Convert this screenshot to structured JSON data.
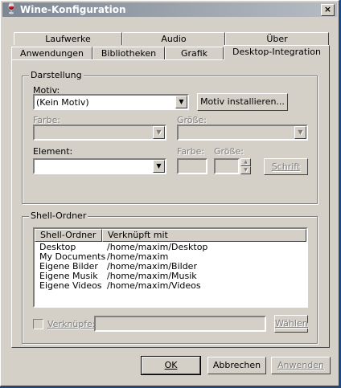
{
  "window": {
    "title": "Wine-Konfiguration",
    "icon": "wine-glass-icon",
    "close": "×"
  },
  "tabs_back": [
    "Laufwerke",
    "Audio",
    "Über"
  ],
  "tabs_front": [
    "Anwendungen",
    "Bibliotheken",
    "Grafik",
    "Desktop-Integration"
  ],
  "appearance": {
    "group_label": "Darstellung",
    "motiv_label": "Motiv:",
    "motiv_value": "(Kein Motiv)",
    "install_button": "Motiv installieren...",
    "farbe_label": "Farbe:",
    "groesse_label": "Größe:",
    "element_label": "Element:",
    "el_farbe_label": "Farbe:",
    "el_groesse_label": "Größe:",
    "schrift_button": "Schrift"
  },
  "shell": {
    "group_label": "Shell-Ordner",
    "columns": [
      "Shell-Ordner",
      "Verknüpft mit"
    ],
    "rows": [
      [
        "Desktop",
        "/home/maxim/Desktop"
      ],
      [
        "My Documents",
        "/home/maxim"
      ],
      [
        "Eigene Bilder",
        "/home/maxim/Bilder"
      ],
      [
        "Eigene Musik",
        "/home/maxim/Musik"
      ],
      [
        "Eigene Videos",
        "/home/maxim/Videos"
      ]
    ],
    "link_label": "Verknüpfe:",
    "choose_button": "Wählen"
  },
  "footer": {
    "ok": "OK",
    "cancel": "Abbrechen",
    "apply": "Anwenden"
  }
}
